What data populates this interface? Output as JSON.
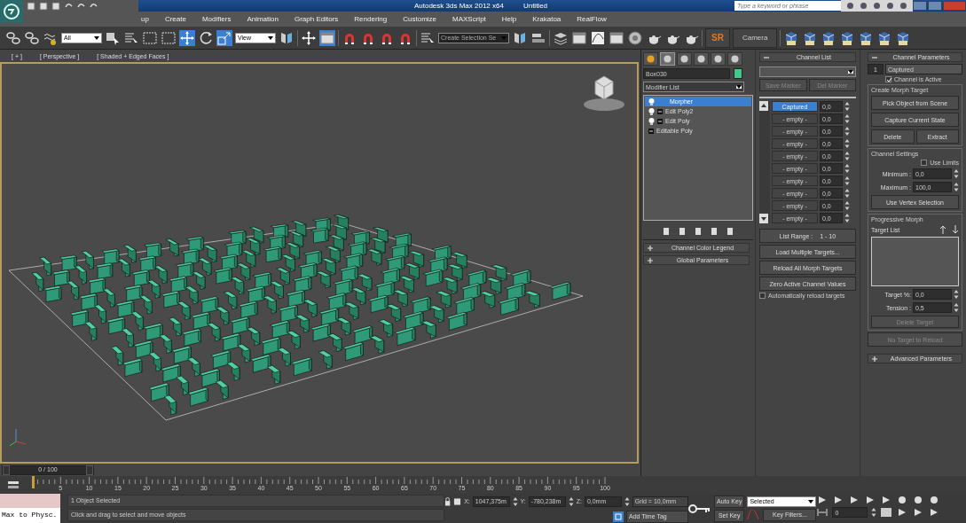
{
  "title_bar": {
    "app_title": "Autodesk 3ds Max  2012 x64",
    "document": "Untitled",
    "search": {
      "placeholder": "Type a keyword or phrase"
    }
  },
  "menu": [
    "up",
    "Create",
    "Modifiers",
    "Animation",
    "Graph Editors",
    "Rendering",
    "Customize",
    "MAXScript",
    "Help",
    "Krakatoa",
    "RealFlow"
  ],
  "toolbar": {
    "selection_filter": "All",
    "reference_coord": "View",
    "named_selection": "Create Selection Se",
    "sr_button": "SR",
    "camera_button": "Camera"
  },
  "viewport": {
    "labels": [
      "[ + ]",
      "[ Perspective ]",
      "[ Shaded + Edged Faces ]"
    ]
  },
  "command_panel": {
    "tabs": [
      {
        "selected": false
      },
      {
        "selected": true
      },
      {
        "selected": false
      },
      {
        "selected": false
      },
      {
        "selected": false
      },
      {
        "selected": false
      }
    ],
    "object_name": "Box030",
    "modifier_list": "Modifier List",
    "stack": [
      {
        "label": "Morpher",
        "kind": "modifier",
        "selected": true
      },
      {
        "label": "Edit Poly2",
        "kind": "editable",
        "selected": false
      },
      {
        "label": "Edit Poly",
        "kind": "editable",
        "selected": false
      },
      {
        "label": "Editable Poly",
        "kind": "base",
        "selected": false
      }
    ],
    "rollouts": [
      {
        "title": "Channel Color Legend",
        "expanded": false
      },
      {
        "title": "Global Parameters",
        "expanded": false
      }
    ]
  },
  "channel_list": {
    "title": "Channel List",
    "expanded": true,
    "buttons": [
      "Save Marker",
      "Del Marker"
    ],
    "channels": [
      {
        "name": "Captured",
        "value": "0,0",
        "selected": true
      },
      {
        "name": "- empty -",
        "value": "0,0",
        "selected": false
      },
      {
        "name": "- empty -",
        "value": "0,0",
        "selected": false
      },
      {
        "name": "- empty -",
        "value": "0,0",
        "selected": false
      },
      {
        "name": "- empty -",
        "value": "0,0",
        "selected": false
      },
      {
        "name": "- empty -",
        "value": "0,0",
        "selected": false
      },
      {
        "name": "- empty -",
        "value": "0,0",
        "selected": false
      },
      {
        "name": "- empty -",
        "value": "0,0",
        "selected": false
      },
      {
        "name": "- empty -",
        "value": "0,0",
        "selected": false
      },
      {
        "name": "- empty -",
        "value": "0,0",
        "selected": false
      }
    ],
    "list_range_label": "List Range :",
    "list_range": "1 - 10",
    "actions": [
      "Load Multiple Targets...",
      "Reload All Morph Targets",
      "Zero Active Channel Values"
    ],
    "auto_reload": {
      "label": "Automatically reload targets",
      "checked": false
    }
  },
  "channel_parameters": {
    "title": "Channel Parameters",
    "expanded": true,
    "number": "1",
    "name": "Captured",
    "channel_active": {
      "label": "Channel is Active",
      "checked": true
    },
    "create_morph_target": {
      "title": "Create Morph Target",
      "buttons": [
        {
          "label": "Pick Object from Scene",
          "disabled": false
        },
        {
          "label": "Capture Current State",
          "disabled": false
        }
      ],
      "delete": "Delete",
      "extract": "Extract"
    },
    "channel_settings": {
      "title": "Channel Settings",
      "use_limits": {
        "label": "Use Limits",
        "checked": false
      },
      "minimum": {
        "label": "Minimum :",
        "value": "0,0"
      },
      "maximum": {
        "label": "Maximum :",
        "value": "100,0"
      },
      "vertex_selection": "Use Vertex Selection"
    },
    "progressive_morph": {
      "title": "Progressive Morph",
      "target_list_label": "Target List",
      "target_pct": {
        "label": "Target %:",
        "value": "0,0"
      },
      "tension": {
        "label": "Tension :",
        "value": "0,5"
      },
      "delete_target": {
        "label": "Delete Target",
        "disabled": true
      }
    },
    "reload": {
      "label": "No Target to Reload",
      "disabled": true
    },
    "advanced": {
      "title": "Advanced Parameters",
      "expanded": false
    }
  },
  "timeline": {
    "position": "0 / 100",
    "level": 0,
    "ticks": [
      "5",
      "10",
      "15",
      "20",
      "25",
      "30",
      "35",
      "40",
      "45",
      "50",
      "55",
      "60",
      "65",
      "70",
      "75",
      "80",
      "85",
      "90",
      "95",
      "100"
    ]
  },
  "status": {
    "listener": "Max to Physc.",
    "selection": "1 Object Selected",
    "prompt": "Click and drag to select and move objects",
    "coords": [
      {
        "label": "X:",
        "value": "1047,375m"
      },
      {
        "label": "Y:",
        "value": "-780,238m"
      },
      {
        "label": "Z:",
        "value": "0,0mm"
      }
    ],
    "grid": "Grid = 10,0mm",
    "add_time_tag": "Add Time Tag",
    "auto_key": "Auto Key",
    "set_key": "Set Key",
    "key_mode": "Selected",
    "key_filters": "Key Filters...",
    "frame": "0"
  }
}
